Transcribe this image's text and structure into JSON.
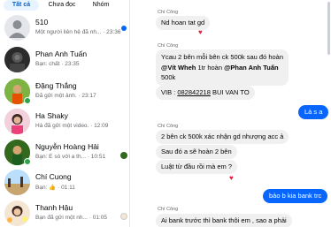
{
  "tabs": [
    "Tất cả",
    "Chưa đọc",
    "Nhóm"
  ],
  "conversations": [
    {
      "name": "510",
      "preview": "Một người liên hệ đã nh...",
      "time": "· 23:36",
      "avatar": "group",
      "bold": false
    },
    {
      "name": "Phan Anh Tuấn",
      "preview": "Bạn: chất",
      "time": "· 23:35",
      "avatar": "photo-dark",
      "bold": false
    },
    {
      "name": "Đặng Thắng",
      "preview": "Đã gửi một ảnh.",
      "time": "· 23:17",
      "avatar": "photo-green",
      "bold": false,
      "online": true
    },
    {
      "name": "Ha Shaky",
      "preview": "Hà đã gửi một video.",
      "time": "· 12:09",
      "avatar": "photo-pink",
      "bold": false
    },
    {
      "name": "Nguyễn Hoàng Hải",
      "preview": "Bạn: E sò với a th...",
      "time": "· 10:51",
      "avatar": "photo-green2",
      "bold": false,
      "online": true
    },
    {
      "name": "Chí Cuong",
      "preview": "Bạn:",
      "time": "· 01:11",
      "avatar": "photo-beach",
      "bold": false
    },
    {
      "name": "Thanh Hậu",
      "preview": "Bạn đã gửi một nh...",
      "time": "· 01:05",
      "avatar": "photo-flower",
      "bold": false
    }
  ],
  "chat": {
    "msg1_sender": "Chí Công",
    "msg1": "Nd hoan tat gd",
    "msg2_sender": "Chí Công",
    "msg2_line1": "Ycau 2 bên mỗi bên ck 500k sau đó hoàn",
    "msg2_line2_a": "@Vít Wheh",
    "msg2_line2_b": " 1tr hoàn ",
    "msg2_line2_c": "@Phan Anh Tuấn",
    "msg2_line3": "500k",
    "msg3_a": "VIB : ",
    "msg3_b": "082842218",
    "msg3_c": " BUI VAN TO",
    "me1": "Là s a",
    "msg4_sender": "Chí Công",
    "msg4": "2 bên ck 500k xác nhận gd nhượng acc ả",
    "msg5": "Sau đó a sẽ hoàn 2 bên",
    "msg6": "Luật từ đầu rồi mà em ?",
    "me2": "bảo b kia bank trc",
    "msg7_sender": "Chí Công",
    "msg7": "Ai bank trước thì bank thôi em , sao a phải"
  },
  "colors": {
    "accent": "#0866ff",
    "bubble": "#f0f0f0",
    "reaction": "#e41e3f"
  }
}
